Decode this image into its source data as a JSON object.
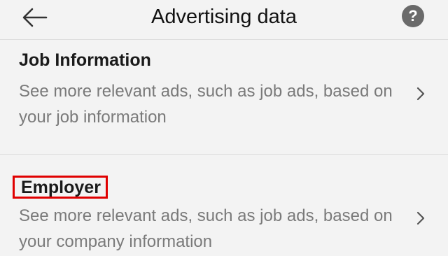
{
  "header": {
    "title": "Advertising data",
    "back_icon": "arrow-left-icon",
    "help_label": "?"
  },
  "items": [
    {
      "title": "Job Information",
      "description": "See more relevant ads, such as job ads, based on your job information"
    },
    {
      "title": "Employer",
      "description": "See more relevant ads, such as job ads, based on your company information"
    }
  ],
  "colors": {
    "background": "#f3f3f3",
    "highlight_border": "#e00000",
    "secondary_text": "#7a7a7a"
  }
}
